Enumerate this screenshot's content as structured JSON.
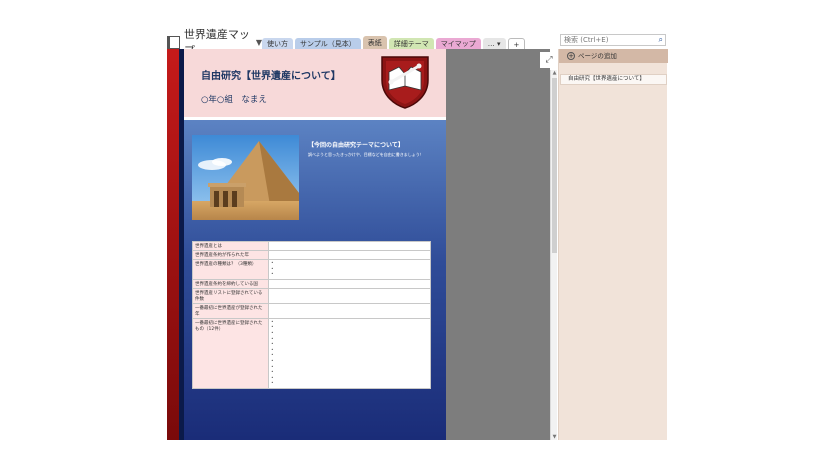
{
  "notebook": {
    "name": "世界遺産マップ"
  },
  "tabs": [
    {
      "label": "使い方",
      "color": "#c9d7ee",
      "active": false
    },
    {
      "label": "サンプル（見本）",
      "color": "#b9cdea",
      "active": false
    },
    {
      "label": "表紙",
      "color": "#d9c3ae",
      "active": true
    },
    {
      "label": "詳細テーマ",
      "color": "#d1e6b3",
      "active": false
    },
    {
      "label": "マイマップ",
      "color": "#eaa9d3",
      "active": false
    },
    {
      "label": "… ▾",
      "color": "#e6e6e6",
      "active": false
    },
    {
      "label": "+",
      "color": "#ffffff",
      "active": false
    }
  ],
  "search": {
    "placeholder": "検索 (Ctrl+E)"
  },
  "page": {
    "title": "自由研究【世界遺産について】",
    "subtitle": "○年○組　なまえ",
    "theme_title": "【今回の自由研究テーマについて】",
    "theme_desc": "調べようと思ったきっかけや、目標などを自由に書きましょう！"
  },
  "table": {
    "rows": [
      {
        "label": "世界遺産とは",
        "dots": 0
      },
      {
        "label": "世界遺産条約が作られた年",
        "dots": 0
      },
      {
        "label": "世界遺産の種類は？（3種類）",
        "dots": 3
      },
      {
        "label": "世界遺産条約を締約している国",
        "dots": 0
      },
      {
        "label": "世界遺産リストに登録されている件数",
        "dots": 0
      },
      {
        "label": "一番最初に世界遺産が登録された年",
        "dots": 0
      },
      {
        "label": "一番最初に世界遺産に登録されたもの（12件）",
        "dots": 12
      }
    ]
  },
  "pages_panel": {
    "add_page": "ページの追加",
    "items": [
      "自由研究【世界遺産について】"
    ]
  }
}
